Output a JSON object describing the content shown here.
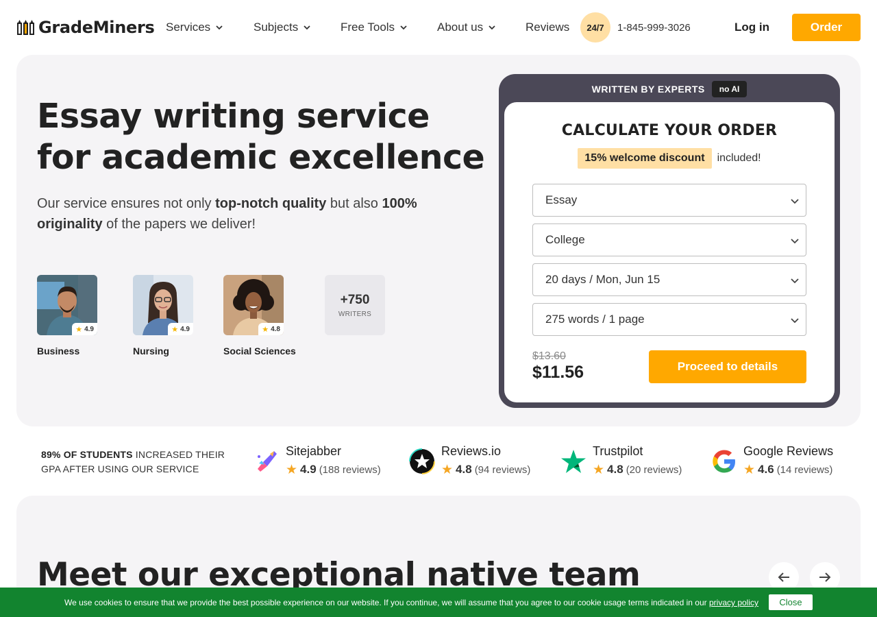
{
  "header": {
    "logo_text": "GradeMiners",
    "nav": [
      {
        "label": "Services"
      },
      {
        "label": "Subjects"
      },
      {
        "label": "Free Tools"
      },
      {
        "label": "About us"
      },
      {
        "label": "Reviews"
      }
    ],
    "support_badge": "24/7",
    "phone": "1-845-999-3026",
    "login_label": "Log in",
    "order_label": "Order"
  },
  "hero": {
    "title": "Essay writing service for academic excellence",
    "subtitle": {
      "p1": "Our service ensures not only ",
      "b1": "top-notch quality",
      "p2": " but also ",
      "b2": "100% originality",
      "p3": " of the papers we deliver!"
    },
    "writers": [
      {
        "subject": "Business",
        "rating": "4.9"
      },
      {
        "subject": "Nursing",
        "rating": "4.9"
      },
      {
        "subject": "Social Sciences",
        "rating": "4.8"
      }
    ],
    "more_writers": {
      "count": "+750",
      "label": "WRITERS"
    }
  },
  "calculator": {
    "header_label": "WRITTEN BY EXPERTS",
    "header_badge": "no AI",
    "title": "CALCULATE YOUR ORDER",
    "discount": "15% welcome discount",
    "discount_suffix": "included!",
    "paper_type": "Essay",
    "academic_level": "College",
    "deadline": "20 days / Mon, Jun 15",
    "pages": "275 words / 1 page",
    "old_price": "$13.60",
    "price": "$11.56",
    "proceed_label": "Proceed to details"
  },
  "trust": {
    "gpa_bold": "89% OF STUDENTS",
    "gpa_rest": " INCREASED THEIR GPA AFTER USING OUR SERVICE",
    "reviews": [
      {
        "name": "Sitejabber",
        "score": "4.9",
        "count": "(188 reviews)",
        "icon": "sitejabber-icon"
      },
      {
        "name": "Reviews.io",
        "score": "4.8",
        "count": "(94 reviews)",
        "icon": "reviewsio-icon"
      },
      {
        "name": "Trustpilot",
        "score": "4.8",
        "count": "(20 reviews)",
        "icon": "trustpilot-icon"
      },
      {
        "name": "Google Reviews",
        "score": "4.6",
        "count": "(14 reviews)",
        "icon": "google-icon"
      }
    ]
  },
  "team": {
    "title": "Meet our exceptional native team"
  },
  "cookie": {
    "text": "We use cookies to ensure that we provide the best possible experience on our website. If you continue, we will assume that you agree to our cookie usage terms indicated in our ",
    "link": "privacy policy",
    "close_label": "Close"
  },
  "colors": {
    "accent": "#ffa800",
    "discount_bg": "#ffdfa4",
    "calc_frame": "#4b4857",
    "cookie_bg": "#12842f",
    "section_bg": "#f5f4f6"
  }
}
